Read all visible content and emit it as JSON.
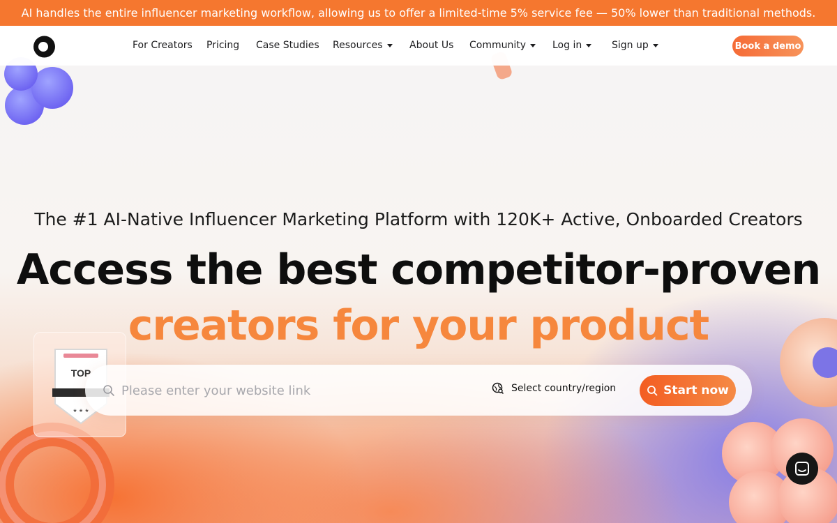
{
  "banner": {
    "text": "AI handles the entire influencer marketing workflow, allowing us to offer a limited-time 5% service fee — 50% lower than traditional methods."
  },
  "nav": {
    "logo_icon": "brand-a-logo",
    "items": [
      {
        "label": "For Creators",
        "dropdown": false
      },
      {
        "label": "Pricing",
        "dropdown": false
      },
      {
        "label": "Case Studies",
        "dropdown": false
      },
      {
        "label": "Resources",
        "dropdown": true
      },
      {
        "label": "About Us",
        "dropdown": false
      },
      {
        "label": "Community",
        "dropdown": true
      },
      {
        "label": "Log in",
        "dropdown": true
      },
      {
        "label": "Sign up",
        "dropdown": true
      }
    ],
    "demo_label": "Book a demo"
  },
  "hero": {
    "subtitle": "The #1 AI-Native Influencer Marketing Platform with 120K+ Active, Onboarded Creators",
    "headline_line1": "Access the best competitor-proven",
    "headline_line2": "creators for your product"
  },
  "badge": {
    "label": "TOP"
  },
  "search": {
    "placeholder": "Please enter your website link",
    "value": "",
    "region_label": "Select country/region",
    "start_label": "Start now"
  },
  "colors": {
    "accent": "#f5772f",
    "headline_gradient_start": "#f56a36",
    "headline_gradient_end": "#f8b04b",
    "text_dark": "#0e0e0e"
  },
  "icons": {
    "search": "search-icon",
    "region": "globe-search-icon",
    "chat": "chat-icon",
    "caret": "chevron-down-icon"
  }
}
